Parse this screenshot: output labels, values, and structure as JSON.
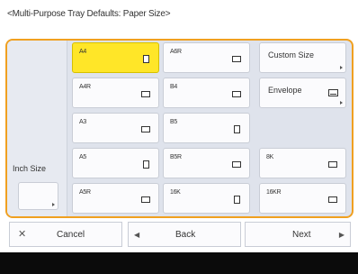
{
  "title": "<Multi-Purpose Tray Defaults: Paper Size>",
  "side": {
    "label": "Inch Size"
  },
  "sizes": {
    "a4": "A4",
    "a4r": "A4R",
    "a3": "A3",
    "a5": "A5",
    "a5r": "A5R",
    "a6r": "A6R",
    "b4": "B4",
    "b5": "B5",
    "b5r": "B5R",
    "16k": "16K",
    "8k": "8K",
    "16kr": "16KR"
  },
  "options": {
    "custom_size": "Custom Size",
    "envelope": "Envelope"
  },
  "nav": {
    "cancel": "Cancel",
    "back": "Back",
    "next": "Next"
  },
  "icons": {
    "cancel": "close-icon",
    "back": "arrow-left-icon",
    "next": "arrow-right-icon",
    "orientation_portrait": "portrait-page-icon",
    "orientation_landscape": "landscape-page-icon",
    "envelope": "envelope-icon"
  },
  "colors": {
    "selected": "#ffe628",
    "panel_border": "#f0a020",
    "panel_bg": "#dfe3ec"
  }
}
